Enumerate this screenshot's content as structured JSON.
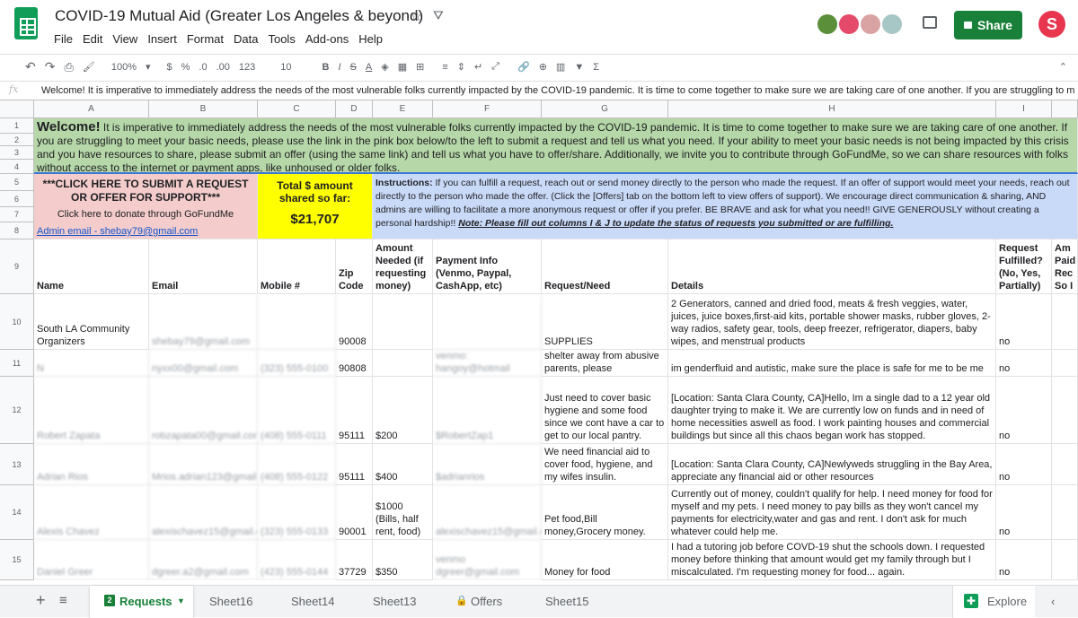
{
  "doc": {
    "title": "COVID-19 Mutual Aid (Greater Los Angeles & beyond)",
    "menu": [
      "File",
      "Edit",
      "View",
      "Insert",
      "Format",
      "Data",
      "Tools",
      "Add-ons",
      "Help"
    ],
    "share_label": "Share",
    "user_initial": "S"
  },
  "toolbar": {
    "zoom": "100%",
    "currency": "$",
    "percent": "%",
    "dec_less": ".0",
    "dec_more": ".00",
    "format_more": "123",
    "font_size": "10",
    "bold": "B",
    "italic": "I",
    "strike": "S",
    "text_color": "A",
    "sigma": "Σ"
  },
  "formula_bar": {
    "fx": "fx",
    "text": "Welcome! It is imperative to immediately address the needs of the most vulnerable folks currently impacted by the COVID-19 pandemic. It is time to come together to make sure we are taking care of one another. If you are struggling to meet your basic needs, please use the link in the pink box below/to the left to submit a request and tell us what you need. If your ability to meet your basic needs is not being impacted by this crisis and you have resources to share"
  },
  "columns": [
    "A",
    "B",
    "C",
    "D",
    "E",
    "F",
    "G",
    "H",
    "I"
  ],
  "row_numbers": [
    "1",
    "2",
    "3",
    "4",
    "5",
    "6",
    "7",
    "8",
    "9",
    "10",
    "11",
    "12",
    "13",
    "14",
    "15"
  ],
  "welcome": {
    "bold": "Welcome!",
    "text": " It is imperative to immediately address the needs of the most vulnerable folks currently impacted by the COVID-19 pandemic. It is time to come together to make sure we are taking care of one another. If you are struggling to meet your basic needs, please use the link in the pink box below/to the left to submit a request and tell us what you need. If your ability to meet your basic needs is not being impacted by this crisis and you have resources to share, please submit an offer (using the same link) and tell us what you have to offer/share. Additionally, we invite you to contribute through GoFundMe, so we can share resources with folks without access to the internet or payment apps, like unhoused or older folks."
  },
  "pink_box": {
    "title": "***CLICK HERE TO SUBMIT A REQUEST OR OFFER FOR SUPPORT***",
    "donate": "Click here to donate through GoFundMe",
    "admin": "Admin email - shebay79@gmail.com"
  },
  "total_box": {
    "label": "Total $ amount shared so far:",
    "amount": "$21,707"
  },
  "instructions": {
    "bold": "Instructions:",
    "text": " If you can fulfill a request, reach out or send money directly to the person who made the request. If an offer of support would meet your needs, reach out directly to the person who made the offer. (Click the [Offers] tab on the bottom left to view offers of support). We encourage direct communication & sharing, AND admins are willing to facilitate a more anonymous request or offer if you prefer. BE BRAVE and ask for what you need!! GIVE GENEROUSLY without creating a personal hardship!! ",
    "note": "Note: Please fill out columns I & J to update the status of requests you submitted or are fulfilling."
  },
  "headers": {
    "name": "Name",
    "email": "Email",
    "mobile": "Mobile #",
    "zip": "Zip Code",
    "amount": "Amount Needed (if requesting money)",
    "payment": "Payment Info (Venmo, Paypal, CashApp, etc)",
    "request": "Request/Need",
    "details": "Details",
    "fulfilled": "Request Fulfilled? (No, Yes, Partially)",
    "paid": "Am Paid Rec So I"
  },
  "rows": [
    {
      "name": "South LA Community Organizers",
      "email": "shebay79@gmail.com",
      "mobile": "",
      "zip": "90008",
      "amount": "",
      "payment": "",
      "request": "SUPPLIES",
      "details": "2 Generators, canned and dried food, meats & fresh veggies, water, juices, juice boxes,first-aid kits, portable shower masks, rubber gloves, 2-way radios, safety gear, tools, deep freezer, refrigerator, diapers, baby wipes, and menstrual products",
      "fulfilled": "no"
    },
    {
      "name": "N",
      "email": "nyxx00@gmail.com",
      "mobile": "(323) 555-0100",
      "zip": "90808",
      "amount": "",
      "payment": "venmo: hangoy@hotmail",
      "request": "shelter away from abusive parents, please",
      "details": "im genderfluid and autistic, make sure the place is safe for me to be me",
      "fulfilled": "no"
    },
    {
      "name": "Robert Zapata",
      "email": "robzapata00@gmail.com",
      "mobile": "(408) 555-0111",
      "zip": "95111",
      "amount": "$200",
      "payment": "$RobertZap1",
      "request": "Just need to cover basic hygiene and some food since we cont have a car to get to our local pantry.",
      "details": "[Location: Santa Clara County, CA]Hello, Im a single dad to a 12 year old daughter trying to make it. We are currently low on funds and in need of home necessities aswell as food. I work painting houses and commercial buildings but since all this chaos began work has stopped.",
      "fulfilled": "no"
    },
    {
      "name": "Adrian Rios",
      "email": "Mrios.adrian123@gmail.com",
      "mobile": "(408) 555-0122",
      "zip": "95111",
      "amount": "$400",
      "payment": "$adrianrios",
      "request": "We need financial aid to cover food, hygiene, and my wifes insulin.",
      "details": "[Location: Santa Clara County, CA]Newlyweds struggling in the Bay Area, appreciate any financial aid or other resources",
      "fulfilled": "no"
    },
    {
      "name": "Alexis Chavez",
      "email": "alexischavez15@gmail.com",
      "mobile": "(323) 555-0133",
      "zip": "90001",
      "amount": "$1000 (Bills, half rent, food)",
      "payment": "alexischavez15@gmail.com",
      "request": "Pet food,Bill money,Grocery money.",
      "details": "Currently out of money, couldn't qualify for help. I need money for food for myself and my pets. I need money to pay bills as they won't cancel my payments for electricity,water and gas and rent. I don't ask for much whatever could help me.",
      "fulfilled": "no"
    },
    {
      "name": "Daniel Greer",
      "email": "dgreer.a2@gmail.com",
      "mobile": "(423) 555-0144",
      "zip": "37729",
      "amount": "$350",
      "payment": "venmo dgreer@gmail.com",
      "request": "Money for food",
      "details": "I had a tutoring job before COVD-19 shut the schools down. I requested money before thinking that amount would get my family through but I miscalculated. I'm requesting money for food... again.",
      "fulfilled": "no"
    }
  ],
  "tabs": [
    "Requests",
    "Sheet16",
    "Sheet14",
    "Sheet13",
    "Offers",
    "Sheet15"
  ],
  "explore_label": "Explore",
  "colors": {
    "green_band": "#b6d7a8",
    "pink_box": "#f4cccc",
    "yellow_box": "#ffff00",
    "blue_box": "#c9daf8",
    "share": "#188038",
    "active_tab": "#188038"
  },
  "icons": [
    "star-icon",
    "drive-icon",
    "comment-icon",
    "undo-icon",
    "redo-icon",
    "print-icon",
    "paint-format-icon",
    "lock-icon",
    "add-sheet-icon",
    "sheet-list-icon",
    "explore-icon",
    "collapse-icon"
  ]
}
